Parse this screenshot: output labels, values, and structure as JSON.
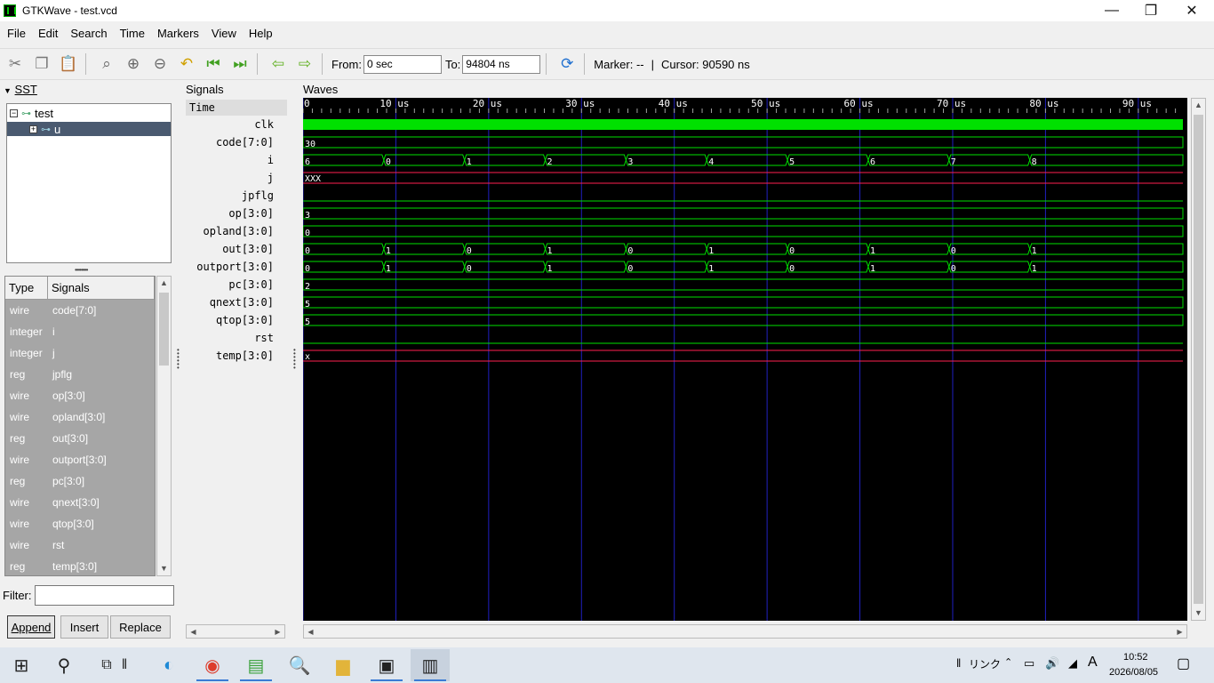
{
  "window": {
    "title": "GTKWave - test.vcd",
    "minimize_glyph": "—",
    "maximize_glyph": "❐",
    "close_glyph": "✕"
  },
  "menubar": [
    "File",
    "Edit",
    "Search",
    "Time",
    "Markers",
    "View",
    "Help"
  ],
  "toolbar": {
    "icons": [
      "cut-icon",
      "copy-icon",
      "paste-icon",
      "zoom-fit-icon",
      "zoom-in-icon",
      "zoom-out-icon",
      "undo-zoom-icon",
      "go-to-start-icon",
      "go-to-end-icon",
      "previous-edge-icon",
      "next-edge-icon",
      "reload-icon"
    ],
    "from_label": "From:",
    "from_value": "0 sec",
    "to_label": "To:",
    "to_value": "94804 ns",
    "marker_text": "Marker: --",
    "sep": "|",
    "cursor_text": "Cursor: 90590 ns"
  },
  "sst": {
    "title": "SST",
    "tree": [
      {
        "label": "test",
        "expander": "−"
      },
      {
        "label": "u",
        "expander": "+",
        "selected": true
      }
    ],
    "list_headers": {
      "type": "Type",
      "signals": "Signals"
    },
    "signals": [
      {
        "type": "wire",
        "name": "code[7:0]"
      },
      {
        "type": "integer",
        "name": "i"
      },
      {
        "type": "integer",
        "name": "j"
      },
      {
        "type": "reg",
        "name": "jpflg"
      },
      {
        "type": "wire",
        "name": "op[3:0]"
      },
      {
        "type": "wire",
        "name": "opland[3:0]"
      },
      {
        "type": "reg",
        "name": "out[3:0]"
      },
      {
        "type": "wire",
        "name": "outport[3:0]"
      },
      {
        "type": "reg",
        "name": "pc[3:0]"
      },
      {
        "type": "wire",
        "name": "qnext[3:0]"
      },
      {
        "type": "wire",
        "name": "qtop[3:0]"
      },
      {
        "type": "wire",
        "name": "rst"
      },
      {
        "type": "reg",
        "name": "temp[3:0]"
      }
    ],
    "filter_label": "Filter:",
    "filter_value": "",
    "buttons": {
      "append": "Append",
      "insert": "Insert",
      "replace": "Replace"
    }
  },
  "signals_panel": {
    "title": "Signals",
    "time_label": "Time",
    "names": [
      "clk",
      "code[7:0]",
      "i",
      "j",
      "jpflg",
      "op[3:0]",
      "opland[3:0]",
      "out[3:0]",
      "outport[3:0]",
      "pc[3:0]",
      "qnext[3:0]",
      "qtop[3:0]",
      "rst",
      "temp[3:0]"
    ]
  },
  "waves": {
    "title": "Waves",
    "time_end_us": 94.804,
    "ticks": [
      {
        "t": 0,
        "label": "0"
      },
      {
        "t": 10,
        "label": "10 us"
      },
      {
        "t": 20,
        "label": "20 us"
      },
      {
        "t": 30,
        "label": "30 us"
      },
      {
        "t": 40,
        "label": "40 us"
      },
      {
        "t": 50,
        "label": "50 us"
      },
      {
        "t": 60,
        "label": "60 us"
      },
      {
        "t": 70,
        "label": "70 us"
      },
      {
        "t": 80,
        "label": "80 us"
      },
      {
        "t": 90,
        "label": "90 us"
      }
    ],
    "colors": {
      "background": "#000000",
      "wave": "#00e000",
      "undefined": "#ff2050",
      "grid": "#2020c0",
      "text": "#ffffff"
    },
    "traces": [
      {
        "kind": "clock"
      },
      {
        "kind": "bus",
        "changes": [
          [
            0,
            "30"
          ]
        ]
      },
      {
        "kind": "bus",
        "changes": [
          [
            0,
            "6"
          ],
          [
            8.7,
            "0"
          ],
          [
            17.4,
            "1"
          ],
          [
            26.1,
            "2"
          ],
          [
            34.8,
            "3"
          ],
          [
            43.5,
            "4"
          ],
          [
            52.2,
            "5"
          ],
          [
            60.9,
            "6"
          ],
          [
            69.6,
            "7"
          ],
          [
            78.3,
            "8"
          ]
        ]
      },
      {
        "kind": "undef",
        "label": "XXX"
      },
      {
        "kind": "low"
      },
      {
        "kind": "bus",
        "changes": [
          [
            0,
            "3"
          ]
        ]
      },
      {
        "kind": "bus",
        "changes": [
          [
            0,
            "0"
          ]
        ]
      },
      {
        "kind": "bus",
        "changes": [
          [
            0,
            "0"
          ],
          [
            8.7,
            "1"
          ],
          [
            17.4,
            "0"
          ],
          [
            26.1,
            "1"
          ],
          [
            34.8,
            "0"
          ],
          [
            43.5,
            "1"
          ],
          [
            52.2,
            "0"
          ],
          [
            60.9,
            "1"
          ],
          [
            69.6,
            "0"
          ],
          [
            78.3,
            "1"
          ]
        ]
      },
      {
        "kind": "bus",
        "changes": [
          [
            0,
            "0"
          ],
          [
            8.7,
            "1"
          ],
          [
            17.4,
            "0"
          ],
          [
            26.1,
            "1"
          ],
          [
            34.8,
            "0"
          ],
          [
            43.5,
            "1"
          ],
          [
            52.2,
            "0"
          ],
          [
            60.9,
            "1"
          ],
          [
            69.6,
            "0"
          ],
          [
            78.3,
            "1"
          ]
        ]
      },
      {
        "kind": "bus",
        "changes": [
          [
            0,
            "2"
          ]
        ]
      },
      {
        "kind": "bus",
        "changes": [
          [
            0,
            "5"
          ]
        ]
      },
      {
        "kind": "bus",
        "changes": [
          [
            0,
            "5"
          ]
        ]
      },
      {
        "kind": "low"
      },
      {
        "kind": "undef",
        "label": "x"
      }
    ]
  },
  "taskbar": {
    "icons": [
      "windows-start-icon",
      "search-icon",
      "task-view-icon",
      "edge-browser-icon",
      "chrome-browser-icon",
      "notepad-icon",
      "file-search-icon",
      "file-explorer-icon",
      "terminal-icon",
      "gtkwave-icon"
    ],
    "tray_links": "リンク",
    "tray_ime": "A",
    "clock_time": "10:52",
    "clock_date": "2026/08/05"
  }
}
